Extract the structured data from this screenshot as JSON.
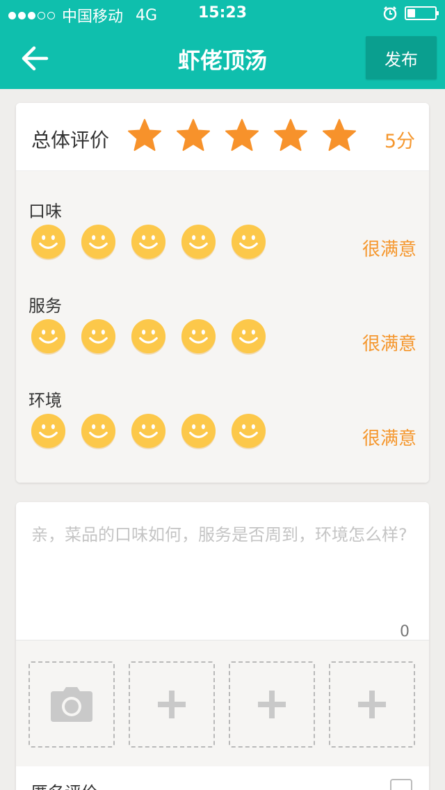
{
  "status_bar": {
    "carrier": "中国移动",
    "network": "4G",
    "time": "15:23",
    "signal_dots_filled": 3,
    "signal_dots_total": 5,
    "battery_level": 0.3
  },
  "nav": {
    "title": "虾佬顶汤",
    "publish_label": "发布",
    "back_icon": "arrow-left-icon"
  },
  "overall": {
    "label": "总体评价",
    "score_text": "5分",
    "stars_filled": 5,
    "stars_total": 5,
    "star_color": "#f7922b"
  },
  "subratings": [
    {
      "label": "口味",
      "value": "很满意",
      "smileys_filled": 5
    },
    {
      "label": "服务",
      "value": "很满意",
      "smileys_filled": 5
    },
    {
      "label": "环境",
      "value": "很满意",
      "smileys_filled": 5
    }
  ],
  "comment": {
    "placeholder": "亲，菜品的口味如何，服务是否周到，环境怎么样?",
    "value": "",
    "char_count": "0"
  },
  "photos": {
    "slots": [
      "camera-icon",
      "plus-icon",
      "plus-icon",
      "plus-icon"
    ]
  },
  "anonymous": {
    "label": "匿名评价",
    "checked": false
  },
  "colors": {
    "brand": "#0fbfad",
    "brand_dark": "#0a9f8f",
    "accent": "#f5972e",
    "smiley": "#fcc84a"
  }
}
